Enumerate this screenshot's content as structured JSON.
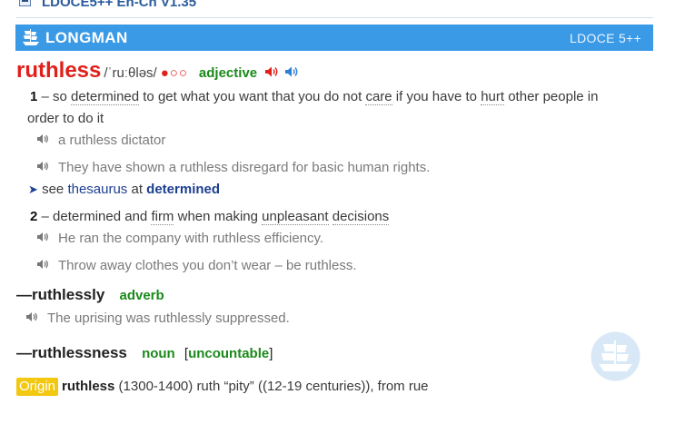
{
  "dictionary": {
    "title": "LDOCE5++ En-Cn V1.35",
    "brand": "LONGMAN",
    "edition": "LDOCE 5++"
  },
  "entry": {
    "headword": "ruthless",
    "pronunciation": "/ˈruːθləs/",
    "frequency": "●○○",
    "part_of_speech": "adjective",
    "senses": [
      {
        "number": "1",
        "dash": "–",
        "definition_line1_parts": [
          "so ",
          "determined",
          " to get what you want that you do not ",
          "care",
          " if you have to ",
          "hurt",
          " other people in"
        ],
        "definition_line2": "order to do it",
        "examples": [
          "a ruthless dictator",
          "They have shown a ruthless disregard for basic human rights."
        ],
        "cross_ref": {
          "arrow": "➤",
          "see": "see",
          "link": "thesaurus",
          "at": "at",
          "target": "determined"
        }
      },
      {
        "number": "2",
        "dash": "–",
        "definition_parts": [
          "determined and ",
          "firm",
          " when making ",
          "unpleasant",
          " ",
          "decisions"
        ],
        "examples": [
          "He ran the company with ruthless efficiency.",
          "Throw away clothes you don’t wear – be ruthless."
        ]
      }
    ],
    "run_ons": [
      {
        "word": "—ruthlessly",
        "pos": "adverb",
        "example": "The uprising was ruthlessly suppressed."
      },
      {
        "word": "—ruthlessness",
        "pos": "noun",
        "grammar_open": "[",
        "grammar": "uncountable",
        "grammar_close": "]"
      }
    ],
    "origin": {
      "label": "Origin",
      "word": "ruthless",
      "text": "(1300-1400) ruth “pity” ((12-19 centuries)), from rue"
    }
  },
  "icons": {
    "collapse": "minus-box-icon",
    "logo": "ship-logo-icon",
    "speaker_british": "speaker-red-icon",
    "speaker_american": "speaker-blue-icon",
    "speaker_example": "speaker-gray-icon"
  },
  "colors": {
    "banner": "#3a9ae6",
    "headword": "#e0201a",
    "pos": "#1a8a1a",
    "link": "#1d3f92",
    "origin": "#f2c811"
  }
}
